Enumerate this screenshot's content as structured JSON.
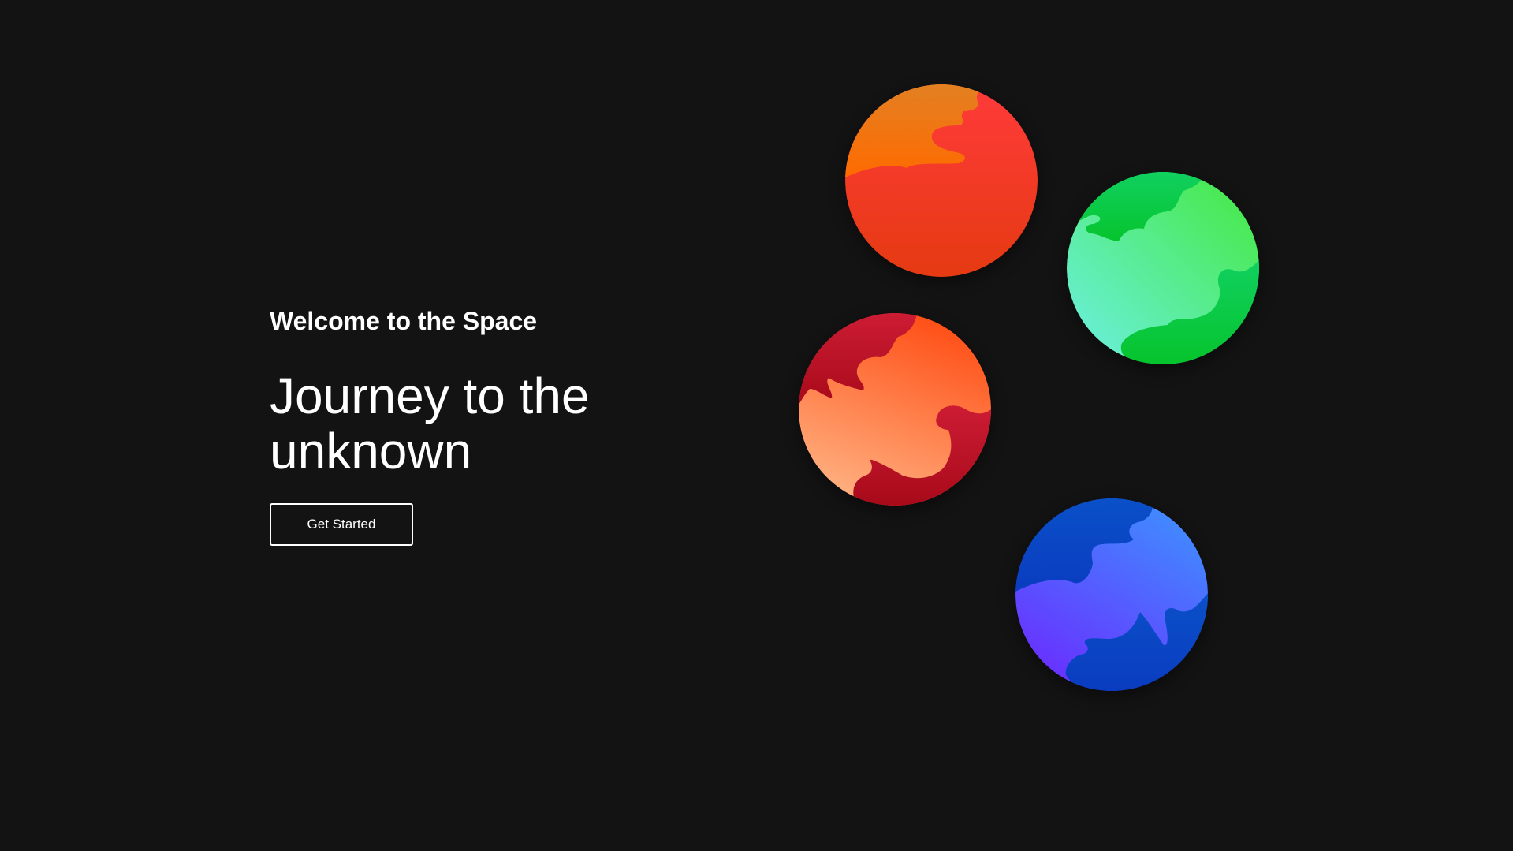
{
  "hero": {
    "eyebrow": "Welcome to the Space",
    "headline_line1": "Journey to the",
    "headline_line2": "unknown",
    "cta_label": "Get Started"
  },
  "theme": {
    "background": "#131313",
    "text": "#ffffff"
  },
  "planets": [
    {
      "name": "orange-planet",
      "base_top": "#ff3a3a",
      "base_bottom": "#e53a12",
      "land_top": "#e38022",
      "land_bottom": "#ff6a00"
    },
    {
      "name": "green-planet",
      "base_top": "#44e83c",
      "base_bottom": "#6df0e6",
      "land_top": "#10d060",
      "land_bottom": "#06c42c"
    },
    {
      "name": "red-planet",
      "base_top": "#ff4b12",
      "base_bottom": "#ffb080",
      "land_top": "#cc1c34",
      "land_bottom": "#a80a1a"
    },
    {
      "name": "blue-planet",
      "base_top": "#3f8fff",
      "base_bottom": "#6a2cff",
      "land_top": "#0a50c8",
      "land_bottom": "#0a3cc0"
    }
  ]
}
